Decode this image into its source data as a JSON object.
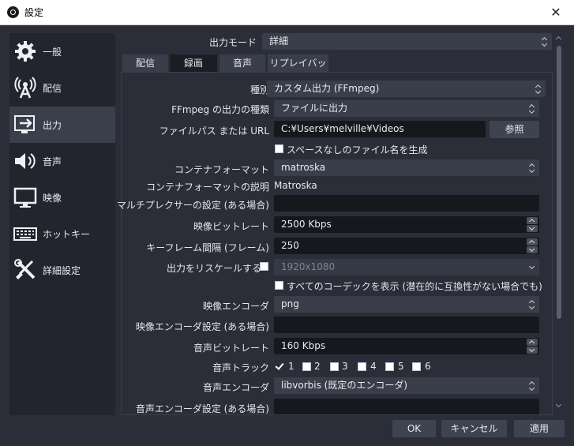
{
  "window": {
    "title": "設定",
    "close_glyph": "✕"
  },
  "sidebar": {
    "items": [
      {
        "label": "一般",
        "icon": "gear-icon"
      },
      {
        "label": "配信",
        "icon": "broadcast-icon"
      },
      {
        "label": "出力",
        "icon": "output-icon",
        "active": true
      },
      {
        "label": "音声",
        "icon": "speaker-icon"
      },
      {
        "label": "映像",
        "icon": "monitor-icon"
      },
      {
        "label": "ホットキー",
        "icon": "keyboard-icon"
      },
      {
        "label": "詳細設定",
        "icon": "tools-icon"
      }
    ]
  },
  "output_mode": {
    "label": "出力モード",
    "value": "詳細"
  },
  "tabs": [
    {
      "label": "配信"
    },
    {
      "label": "録画",
      "active": true
    },
    {
      "label": "音声"
    },
    {
      "label": "リプレイバッファ"
    }
  ],
  "form": {
    "type_label": "種別",
    "type_value": "カスタム出力 (FFmpeg)",
    "ffmpeg_output_label": "FFmpeg の出力の種類",
    "ffmpeg_output_value": "ファイルに出力",
    "filepath_label": "ファイルパス または URL",
    "filepath_value": "C:¥Users¥melville¥Videos",
    "browse_label": "参照",
    "no_space_label": "スペースなしのファイル名を生成",
    "container_label": "コンテナフォーマット",
    "container_value": "matroska",
    "container_desc_label": "コンテナフォーマットの説明",
    "container_desc_value": "Matroska",
    "muxer_label": "マルチプレクサーの設定 (ある場合)",
    "muxer_value": "",
    "video_bitrate_label": "映像ビットレート",
    "video_bitrate_value": "2500 Kbps",
    "keyframe_label": "キーフレーム間隔 (フレーム)",
    "keyframe_value": "250",
    "rescale_label": "出力をリスケールする",
    "rescale_value": "1920x1080",
    "show_all_codecs_label": "すべてのコーデックを表示 (潜在的に互換性がない場合でも)",
    "video_encoder_label": "映像エンコーダ",
    "video_encoder_value": "png",
    "video_encoder_settings_label": "映像エンコーダ設定 (ある場合)",
    "video_encoder_settings_value": "",
    "audio_bitrate_label": "音声ビットレート",
    "audio_bitrate_value": "160 Kbps",
    "audio_track_label": "音声トラック",
    "tracks": [
      {
        "label": "1",
        "checked": true
      },
      {
        "label": "2",
        "checked": false
      },
      {
        "label": "3",
        "checked": false
      },
      {
        "label": "4",
        "checked": false
      },
      {
        "label": "5",
        "checked": false
      },
      {
        "label": "6",
        "checked": false
      }
    ],
    "audio_encoder_label": "音声エンコーダ",
    "audio_encoder_value": "libvorbis (既定のエンコーダ)",
    "audio_encoder_settings_label": "音声エンコーダ設定 (ある場合)",
    "audio_encoder_settings_value": ""
  },
  "buttons": {
    "ok": "OK",
    "cancel": "キャンセル",
    "apply": "適用"
  }
}
